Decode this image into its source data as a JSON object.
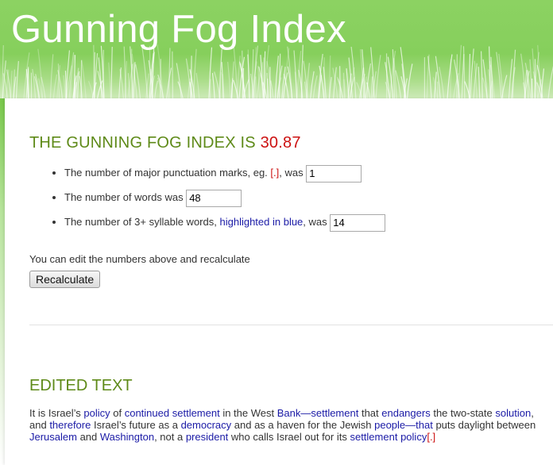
{
  "header": {
    "title": "Gunning Fog Index"
  },
  "result": {
    "label": "THE GUNNING FOG INDEX IS",
    "score": "30.87"
  },
  "stats": {
    "punctuation": {
      "label_pre": "The number of major punctuation marks, eg.",
      "example": "[.]",
      "label_post": ", was",
      "value": "1"
    },
    "words": {
      "label": "The number of words was",
      "value": "48"
    },
    "syllables": {
      "label_pre": "The number of 3+ syllable words,",
      "highlight": "highlighted in blue",
      "label_post": ", was",
      "value": "14"
    }
  },
  "hint": "You can edit the numbers above and recalculate",
  "recalculate_label": "Recalculate",
  "edited": {
    "heading": "EDITED TEXT",
    "segments": [
      {
        "t": "It is Israel’s ",
        "c": ""
      },
      {
        "t": "policy",
        "c": "blue"
      },
      {
        "t": " of ",
        "c": ""
      },
      {
        "t": "continued",
        "c": "blue"
      },
      {
        "t": " ",
        "c": ""
      },
      {
        "t": "settlement",
        "c": "blue"
      },
      {
        "t": " in the West ",
        "c": ""
      },
      {
        "t": "Bank—settlement",
        "c": "blue"
      },
      {
        "t": " that ",
        "c": ""
      },
      {
        "t": "endangers",
        "c": "blue"
      },
      {
        "t": " the two-state ",
        "c": ""
      },
      {
        "t": "solution",
        "c": "blue"
      },
      {
        "t": ", and ",
        "c": ""
      },
      {
        "t": "therefore",
        "c": "blue"
      },
      {
        "t": " Israel’s future as a ",
        "c": ""
      },
      {
        "t": "democracy",
        "c": "blue"
      },
      {
        "t": " and as a haven for the Jewish ",
        "c": ""
      },
      {
        "t": "people—that",
        "c": "blue"
      },
      {
        "t": " puts daylight between ",
        "c": ""
      },
      {
        "t": "Jerusalem",
        "c": "blue"
      },
      {
        "t": " and ",
        "c": ""
      },
      {
        "t": "Washington",
        "c": "blue"
      },
      {
        "t": ", not a ",
        "c": ""
      },
      {
        "t": "president",
        "c": "blue"
      },
      {
        "t": " who calls Israel out for its ",
        "c": ""
      },
      {
        "t": "settlement",
        "c": "blue"
      },
      {
        "t": " ",
        "c": ""
      },
      {
        "t": "policy",
        "c": "blue"
      },
      {
        "t": "[.]",
        "c": "red"
      }
    ]
  },
  "colors": {
    "header_green": "#86cf5c",
    "heading_green": "#5e8a18",
    "score_red": "#cc1111",
    "highlight_blue": "#1a1aa6"
  }
}
